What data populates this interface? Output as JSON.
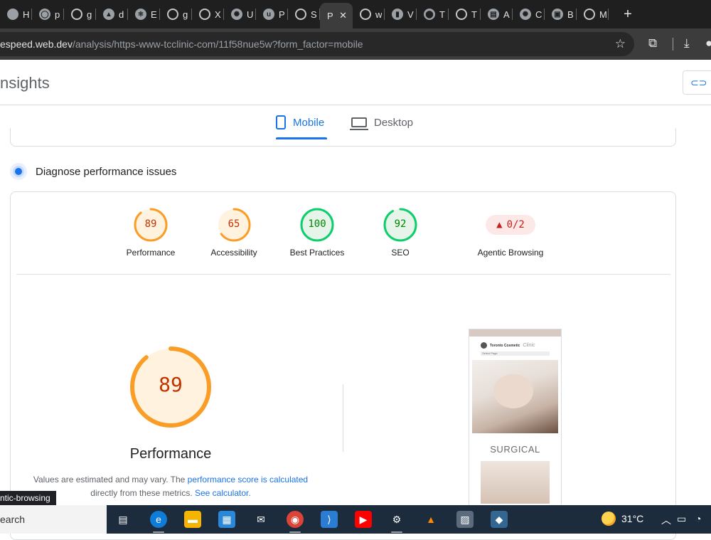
{
  "tabs": [
    {
      "title": "H",
      "icon": "tab-icon"
    },
    {
      "title": "p",
      "icon": "github-icon"
    },
    {
      "title": "g",
      "icon": "globe-icon"
    },
    {
      "title": "d",
      "icon": "triangle-icon"
    },
    {
      "title": "E",
      "icon": "react-icon"
    },
    {
      "title": "g",
      "icon": "globe-icon"
    },
    {
      "title": "X",
      "icon": "globe-icon"
    },
    {
      "title": "U",
      "icon": "openai-icon"
    },
    {
      "title": "P",
      "icon": "upwork-icon"
    },
    {
      "title": "S",
      "icon": "globe-icon"
    },
    {
      "title": "P",
      "icon": "pagespeed-icon",
      "active": true
    },
    {
      "title": "w",
      "icon": "globe-icon"
    },
    {
      "title": "V",
      "icon": "analytics-icon"
    },
    {
      "title": "T",
      "icon": "maps-icon"
    },
    {
      "title": "T",
      "icon": "globe-icon"
    },
    {
      "title": "A",
      "icon": "docs-icon"
    },
    {
      "title": "C",
      "icon": "openai-icon"
    },
    {
      "title": "B",
      "icon": "bookmark-icon"
    },
    {
      "title": "M",
      "icon": "globe-icon"
    }
  ],
  "address": {
    "host": "espeed.web.dev",
    "path": "/analysis/https-www-tcclinic-com/11f58nue5w?form_factor=mobile"
  },
  "header": {
    "brand": "nsights",
    "copy_label": "C"
  },
  "device_tabs": {
    "mobile": "Mobile",
    "desktop": "Desktop"
  },
  "diagnose": {
    "title": "Diagnose performance issues"
  },
  "scores": [
    {
      "label": "Performance",
      "score": 89,
      "color": "#fa9d26",
      "text_color": "#c33300",
      "fill": "#fff3e0"
    },
    {
      "label": "Accessibility",
      "score": 65,
      "color": "#fa9d26",
      "text_color": "#c33300",
      "fill": "#fff3e0"
    },
    {
      "label": "Best Practices",
      "score": 100,
      "color": "#0cce6b",
      "text_color": "#008800",
      "fill": "#e6f4ea"
    },
    {
      "label": "SEO",
      "score": 92,
      "color": "#0cce6b",
      "text_color": "#008800",
      "fill": "#e6f4ea"
    }
  ],
  "agentic": {
    "label": "Agentic Browsing",
    "value": "0/2"
  },
  "performance": {
    "score": 89,
    "label": "Performance",
    "note_1": "Values are estimated and may vary. The ",
    "note_link_1": "performance score is calculated",
    "note_2": "directly from these metrics. ",
    "note_link_2": "See calculator."
  },
  "screenshot": {
    "surgical": "SURGICAL",
    "brand": "Toronto Cosmetic",
    "brand_script": "Clinic",
    "select": "Select Page"
  },
  "tooltip": "ntic-browsing",
  "taskbar": {
    "search": "earch",
    "temperature": "31°C"
  }
}
